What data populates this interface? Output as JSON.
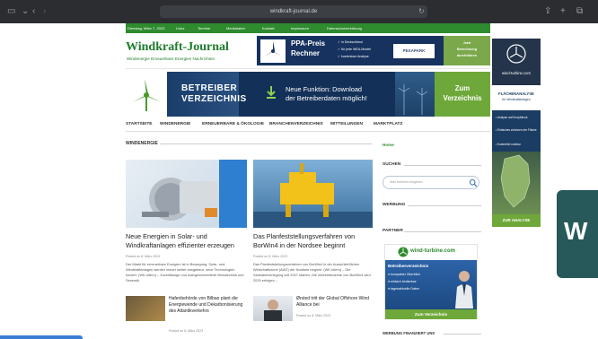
{
  "browser": {
    "url": "windkraft-journal.de"
  },
  "topbar": {
    "date": "Dienstag, März 7, 2023",
    "links": [
      "Links",
      "Termine",
      "Mediadaten",
      "Kontakt",
      "Impressum",
      "Datenschutzerklärung"
    ]
  },
  "header": {
    "title": "Windkraft-Journal",
    "subtitle": "Windenergie Erneuerbare Energien Nachrichten",
    "ppa_banner": {
      "title_line1": "PPA-Preis",
      "title_line2": "Rechner",
      "checks": [
        "in Deutschland",
        "für jede WEA-Modell",
        "kostenlose Analyse"
      ],
      "sponsor": "PEXAPARK",
      "cta_line1": "Jetzt",
      "cta_line2": "Berechnung",
      "cta_line3": "durchführen"
    }
  },
  "banner2": {
    "title_line1": "BETREIBER",
    "title_line2": "VERZEICHNIS",
    "feature_line1": "Neue Funktion: Download",
    "feature_line2": "der Betreiberdaten möglich!",
    "cta_line1": "Zum",
    "cta_line2": "Verzeichnis"
  },
  "nav": {
    "items": [
      "STARTSEITE",
      "WINDENERGIE",
      "ERNEUERBARE & ÖKOLOGIE",
      "BRANCHENVERZEICHNIS",
      "MITTEILUNGEN",
      "MARKTPLATZ"
    ]
  },
  "main": {
    "section": "WINDENERGIE",
    "articles": [
      {
        "title": "Neue Energien in Solar- und Windkraftanlagen effizienter erzeugen",
        "meta": "Posted on 8. März 2023",
        "excerpt": "Der Markt für erneuerbare Energien ist in Bewegung: Solar- und Windkraftanlagen werden immer weiter ausgebaut, neue Technologien forciert. (WK-intern) – Zuverlässige und maßgeschneiderte Messtechnik und Sensorik"
      },
      {
        "title": "Das Planfeststellungsverfahren von BorWin4 in der Nordsee beginnt",
        "meta": "Posted on 8. März 2023",
        "excerpt": "Das Planfeststellungsverfahren von BorWin4 in der Ausschließlichen Wirtschaftszone (AWZ) der Nordsee beginnt. (WK-intern) – Die Seekabelverlegung soll 2027 starten. Die Inbetriebnahme von BorWin4 wird 2029 erfolgen –"
      }
    ],
    "small_articles": [
      {
        "title": "Hafenbehörde von Bilbao plant die Energiewende und Dekarbonisierung des Atlantikverkehrs",
        "meta": "Posted on 8. März 2023"
      },
      {
        "title": "Ørsted tritt der Global Offshore Wind Alliance bei",
        "meta": "Posted on 8. März 2023"
      }
    ]
  },
  "sidebar": {
    "home_link": "Home",
    "search_label": "SUCHEN",
    "search_placeholder": "Was fortsetzt eingeben",
    "werbung_label": "WERBUNG",
    "partner_label": "PARTNER",
    "partner_ad": {
      "site": "wind-turbine.com",
      "heading": "Betreiberverzeichnis",
      "bullets": [
        "kompakter Überblick",
        "einfach bedienbar",
        "tagesaktuelle Daten"
      ],
      "cta": "Zum Verzeichnis"
    },
    "werbung_finanziert": "WERBUNG FINANZIERT UNS"
  },
  "right_ad": {
    "site": "wind-turbine.com",
    "heading": "FLÄCHENANALYSE",
    "subheading": "für Windkraftanlagen",
    "features": [
      "Analyse auf Knopfdruck",
      "Einfaches zeichnen der Fläche",
      "Kostenfrei nutzbar"
    ],
    "cta": "ZUR ANALYSE"
  },
  "edge": {
    "letter": "W"
  },
  "colors": {
    "brand_green": "#2e8b2e",
    "navy": "#133058",
    "chrome": "#2b2d31"
  }
}
